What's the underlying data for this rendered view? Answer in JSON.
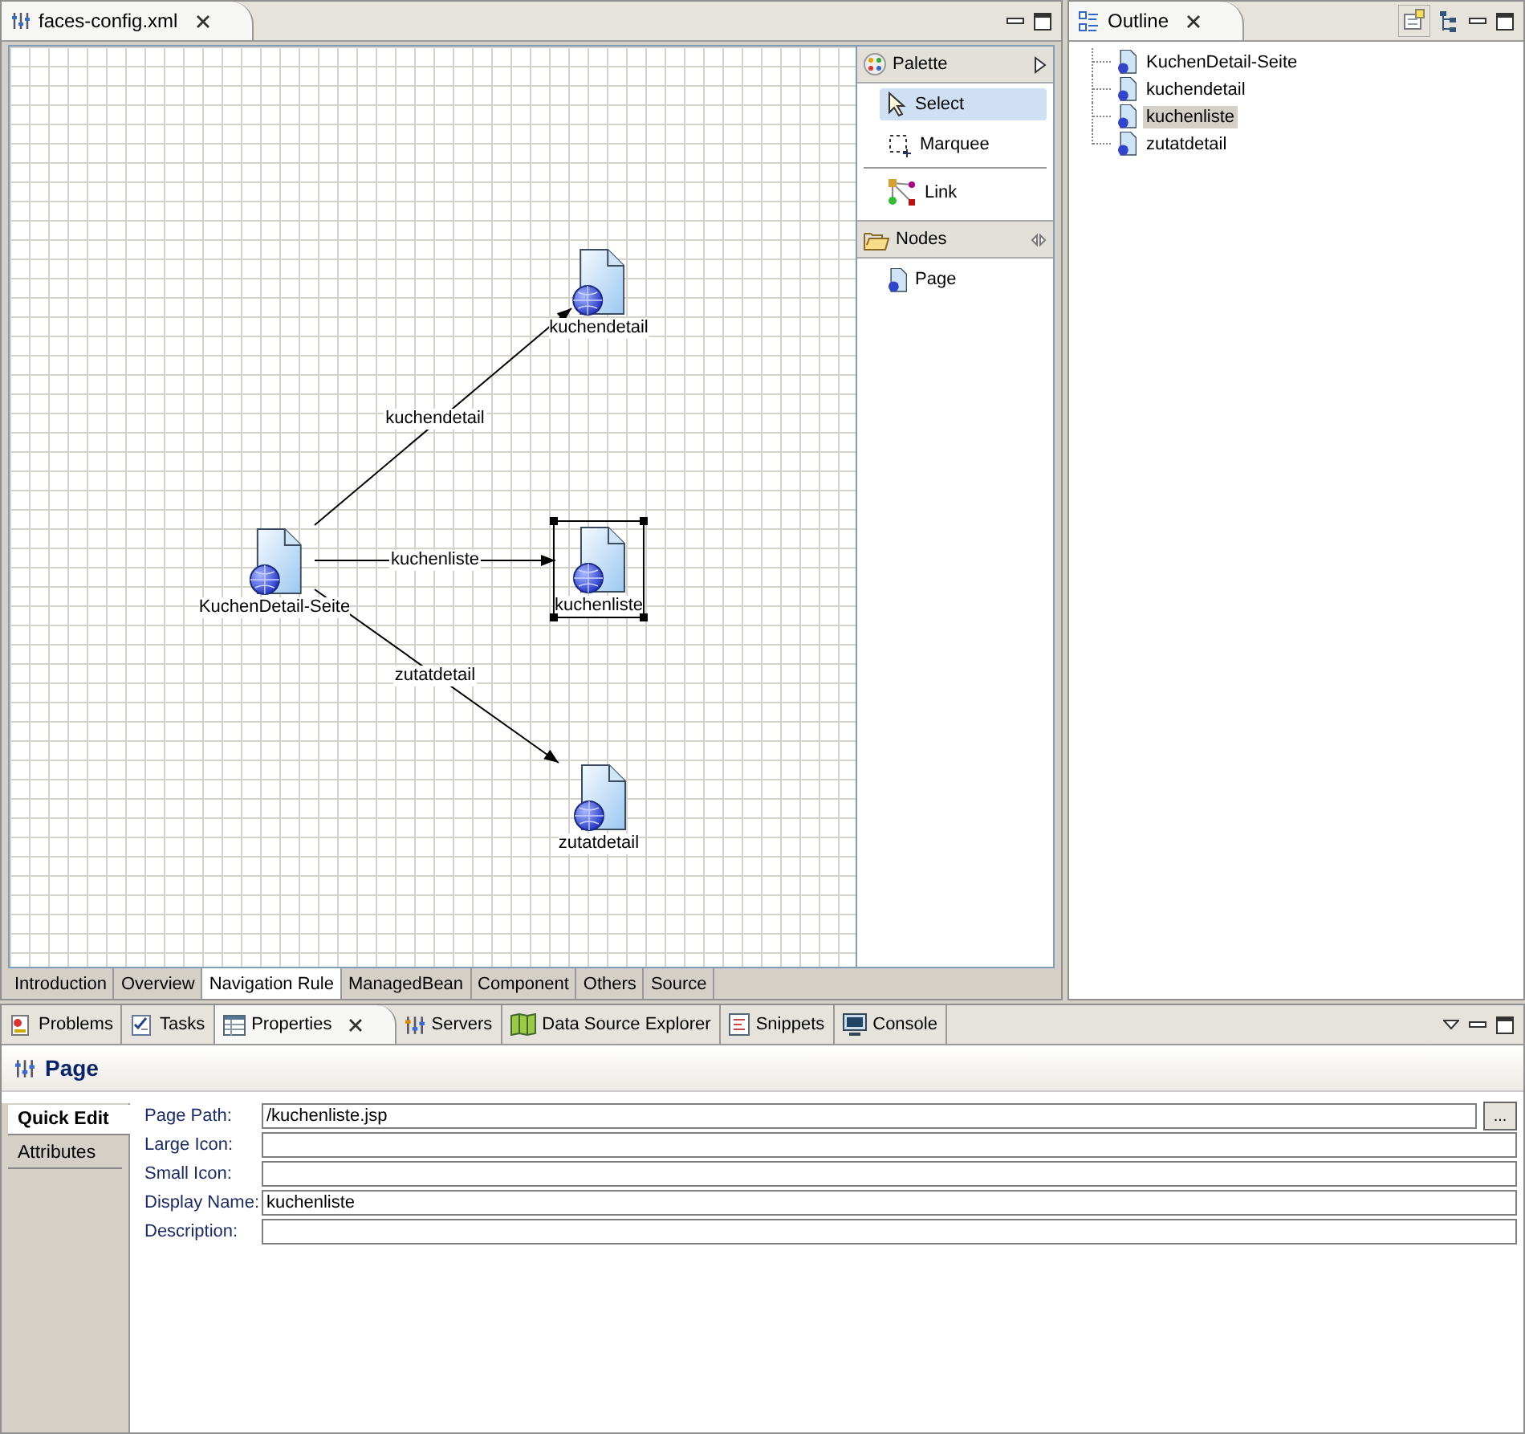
{
  "editor": {
    "title": "faces-config.xml",
    "nodes": [
      {
        "label": "KuchenDetail-Seite",
        "selected": false
      },
      {
        "label": "kuchendetail",
        "selected": false
      },
      {
        "label": "kuchenliste",
        "selected": true
      },
      {
        "label": "zutatdetail",
        "selected": false
      }
    ],
    "edges": [
      {
        "label": "kuchendetail"
      },
      {
        "label": "kuchenliste"
      },
      {
        "label": "zutatdetail"
      }
    ],
    "palette": {
      "title": "Palette",
      "tools": [
        {
          "kind": "select",
          "label": "Select",
          "selected": true
        },
        {
          "kind": "marquee",
          "label": "Marquee",
          "selected": false
        },
        {
          "kind": "link",
          "label": "Link",
          "selected": false
        }
      ],
      "drawer": {
        "title": "Nodes",
        "items": [
          {
            "label": "Page"
          }
        ]
      }
    },
    "tabs": [
      {
        "label": "Introduction",
        "selected": false
      },
      {
        "label": "Overview",
        "selected": false
      },
      {
        "label": "Navigation Rule",
        "selected": true
      },
      {
        "label": "ManagedBean",
        "selected": false
      },
      {
        "label": "Component",
        "selected": false
      },
      {
        "label": "Others",
        "selected": false
      },
      {
        "label": "Source",
        "selected": false
      }
    ]
  },
  "outline": {
    "title": "Outline",
    "items": [
      {
        "label": "KuchenDetail-Seite",
        "selected": false
      },
      {
        "label": "kuchendetail",
        "selected": false
      },
      {
        "label": "kuchenliste",
        "selected": true
      },
      {
        "label": "zutatdetail",
        "selected": false
      }
    ]
  },
  "views": {
    "tabs": [
      {
        "kind": "problems",
        "label": "Problems",
        "selected": false
      },
      {
        "kind": "tasks",
        "label": "Tasks",
        "selected": false
      },
      {
        "kind": "properties",
        "label": "Properties",
        "selected": true
      },
      {
        "kind": "servers",
        "label": "Servers",
        "selected": false
      },
      {
        "kind": "datasource",
        "label": "Data Source Explorer",
        "selected": false
      },
      {
        "kind": "snippets",
        "label": "Snippets",
        "selected": false
      },
      {
        "kind": "console",
        "label": "Console",
        "selected": false
      }
    ]
  },
  "properties": {
    "title": "Page",
    "side_tabs": [
      {
        "label": "Quick Edit",
        "selected": true
      },
      {
        "label": "Attributes",
        "selected": false
      }
    ],
    "fields": [
      {
        "label": "Page Path:",
        "value": "/kuchenliste.jsp",
        "browse": "..."
      },
      {
        "label": "Large Icon:"
      },
      {
        "label": "Small Icon:"
      },
      {
        "label": "Display Name:",
        "value": "kuchenliste"
      },
      {
        "label": "Description:"
      }
    ]
  }
}
